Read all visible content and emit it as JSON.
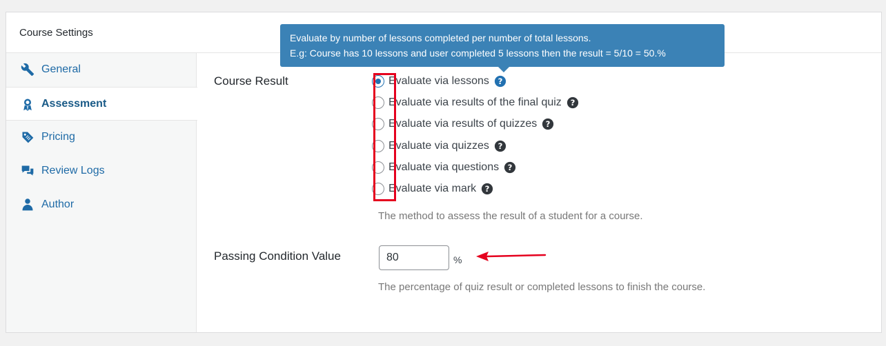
{
  "header": {
    "title": "Course Settings"
  },
  "sidebar": {
    "tabs": [
      {
        "label": "General",
        "icon": "wrench-icon"
      },
      {
        "label": "Assessment",
        "icon": "award-icon",
        "active": true
      },
      {
        "label": "Pricing",
        "icon": "price-tag-icon"
      },
      {
        "label": "Review Logs",
        "icon": "chat-bubbles-icon"
      },
      {
        "label": "Author",
        "icon": "user-icon"
      }
    ]
  },
  "course_result": {
    "label": "Course Result",
    "options": [
      {
        "label": "Evaluate via lessons",
        "checked": true
      },
      {
        "label": "Evaluate via results of the final quiz",
        "checked": false
      },
      {
        "label": "Evaluate via results of quizzes",
        "checked": false
      },
      {
        "label": "Evaluate via quizzes",
        "checked": false
      },
      {
        "label": "Evaluate via questions",
        "checked": false
      },
      {
        "label": "Evaluate via mark",
        "checked": false
      }
    ],
    "description": "The method to assess the result of a student for a course."
  },
  "tooltip": {
    "line1": "Evaluate by number of lessons completed per number of total lessons.",
    "line2": "E.g: Course has 10 lessons and user completed 5 lessons then the result = 5/10 = 50.%"
  },
  "passing_condition": {
    "label": "Passing Condition Value",
    "value": "80",
    "unit": "%",
    "description": "The percentage of quiz result or completed lessons to finish the course."
  },
  "colors": {
    "accent": "#2271b1",
    "tooltip_bg": "#3b82b6",
    "annotation_red": "#e5001e"
  }
}
